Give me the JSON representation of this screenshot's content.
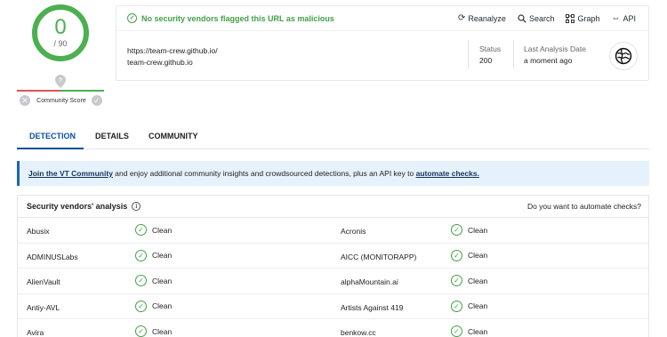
{
  "score": {
    "value": "0",
    "total": "/ 90",
    "community_label": "Community Score",
    "colors": {
      "good": "#4caf50",
      "bad": "#e05454"
    }
  },
  "summary": {
    "verdict": "No security vendors flagged this URL as malicious",
    "actions": [
      {
        "icon": "reanalyze-icon",
        "label": "Reanalyze"
      },
      {
        "icon": "search-icon",
        "label": "Search"
      },
      {
        "icon": "graph-icon",
        "label": "Graph"
      },
      {
        "icon": "api-icon",
        "label": "API"
      }
    ],
    "url": "https://team-crew.github.io/",
    "host": "team-crew.github.io",
    "status_label": "Status",
    "status_value": "200",
    "last_analysis_label": "Last Analysis Date",
    "last_analysis_value": "a moment ago"
  },
  "tabs": [
    {
      "label": "DETECTION",
      "active": true
    },
    {
      "label": "DETAILS",
      "active": false
    },
    {
      "label": "COMMUNITY",
      "active": false
    }
  ],
  "banner": {
    "link1": "Join the VT Community",
    "text": " and enjoy additional community insights and crowdsourced detections, plus an API key to ",
    "link2": "automate checks."
  },
  "vendors": {
    "title": "Security vendors' analysis",
    "automate_link": "Do you want to automate checks?",
    "rows": [
      {
        "left_name": "Abusix",
        "left_result": "Clean",
        "right_name": "Acronis",
        "right_result": "Clean"
      },
      {
        "left_name": "ADMINUSLabs",
        "left_result": "Clean",
        "right_name": "AICC (MONITORAPP)",
        "right_result": "Clean"
      },
      {
        "left_name": "AlienVault",
        "left_result": "Clean",
        "right_name": "alphaMountain.ai",
        "right_result": "Clean"
      },
      {
        "left_name": "Antiy-AVL",
        "left_result": "Clean",
        "right_name": "Artists Against 419",
        "right_result": "Clean"
      },
      {
        "left_name": "Avira",
        "left_result": "Clean",
        "right_name": "benkow.cc",
        "right_result": "Clean"
      }
    ]
  }
}
